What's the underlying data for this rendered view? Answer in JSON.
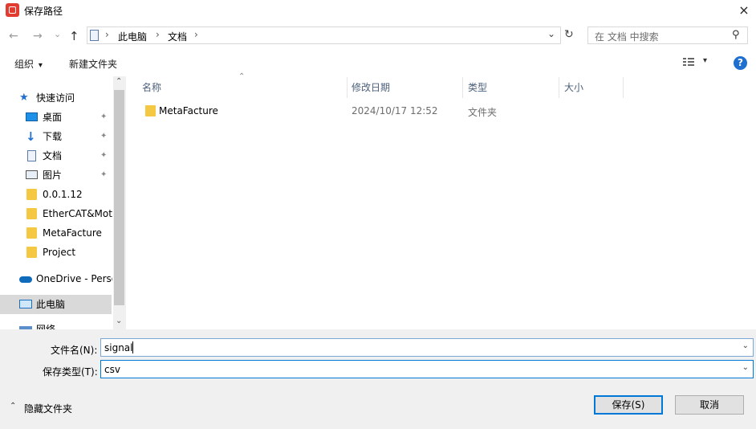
{
  "window": {
    "title": "保存路径",
    "close_icon": "×"
  },
  "nav": {
    "back_icon": "←",
    "forward_icon": "→",
    "history_icon": "⌄",
    "up_icon": "↑",
    "breadcrumb": [
      "此电脑",
      "文档"
    ],
    "breadcrumb_sep": "›",
    "refresh_icon": "↻",
    "dropdown_icon": "⌄",
    "search_placeholder": "在 文档 中搜索",
    "search_icon": "⚲"
  },
  "toolbar": {
    "organize_label": "组织",
    "organize_arrow": "▾",
    "new_folder_label": "新建文件夹",
    "view_arrow": "▾",
    "help_label": "?"
  },
  "sidebar": {
    "quick_access_label": "快速访问",
    "items": [
      {
        "label": "桌面",
        "pinned": true
      },
      {
        "label": "下载",
        "pinned": true
      },
      {
        "label": "文档",
        "pinned": true
      },
      {
        "label": "图片",
        "pinned": true
      },
      {
        "label": "0.0.1.12",
        "pinned": false
      },
      {
        "label": "EtherCAT&Motion",
        "pinned": false
      },
      {
        "label": "MetaFacture",
        "pinned": false
      },
      {
        "label": "Project",
        "pinned": false
      }
    ],
    "onedrive_label": "OneDrive - Personal",
    "this_pc_label": "此电脑",
    "network_label": "网络",
    "pin_icon": "📌",
    "scroll_up": "⌃",
    "scroll_down": "⌄"
  },
  "file_list": {
    "sort_indicator": "⌃",
    "columns": [
      "名称",
      "修改日期",
      "类型",
      "大小"
    ],
    "rows": [
      {
        "name": "MetaFacture",
        "modified": "2024/10/17 12:52",
        "type": "文件夹",
        "size": ""
      }
    ]
  },
  "form": {
    "filename_label": "文件名(N):",
    "filename_value": "signal",
    "filetype_label": "保存类型(T):",
    "filetype_value": "csv",
    "combo_arrow": "⌄"
  },
  "footer": {
    "hide_folders_label": "隐藏文件夹",
    "hide_folders_icon": "⌃",
    "save_label": "保存(S)",
    "cancel_label": "取消"
  }
}
